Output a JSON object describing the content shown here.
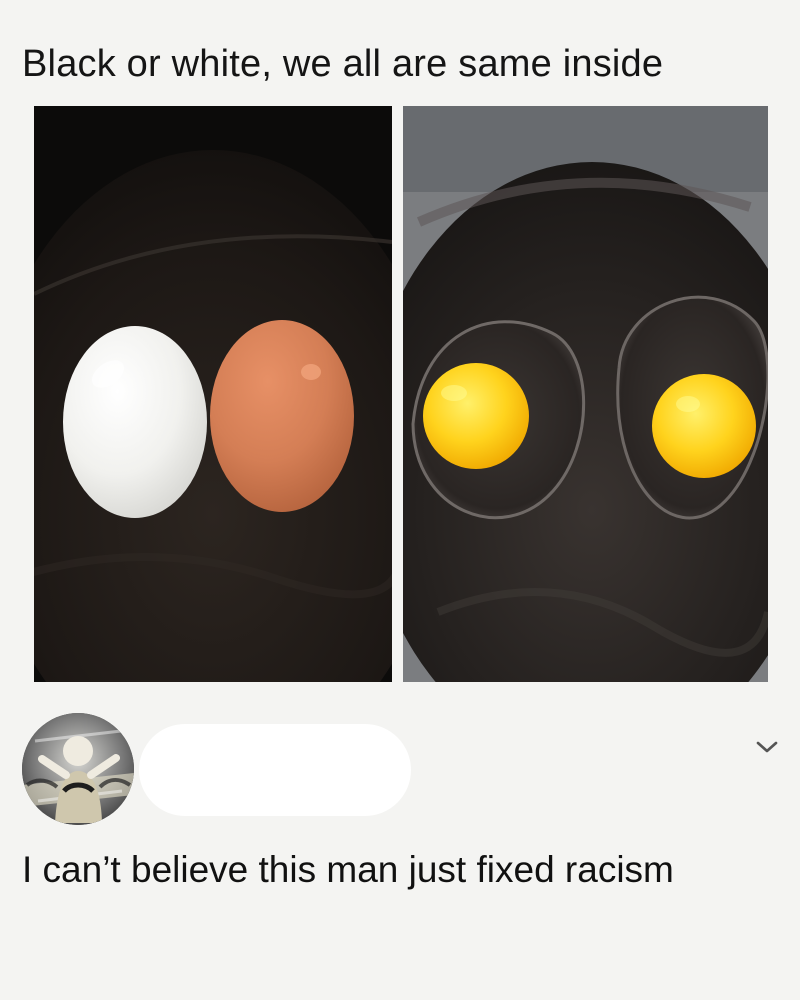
{
  "post": {
    "caption": "Black or white, we all are same inside",
    "panels": [
      {
        "name": "whole-eggs-photo",
        "content": [
          "white-egg",
          "brown-egg"
        ]
      },
      {
        "name": "cracked-eggs-photo",
        "content": [
          "fried-egg",
          "fried-egg"
        ]
      }
    ]
  },
  "comment": {
    "avatar_icon": "profile-avatar",
    "username_redacted": true,
    "menu_icon": "chevron-down-icon",
    "text": "I can’t believe this man just fixed racism"
  },
  "colors": {
    "background": "#f4f4f2",
    "text": "#151515",
    "pan": "#1b1917",
    "white_egg": "#f3f3f0",
    "brown_egg": "#d47e55",
    "yolk": "#ffcf1a"
  }
}
